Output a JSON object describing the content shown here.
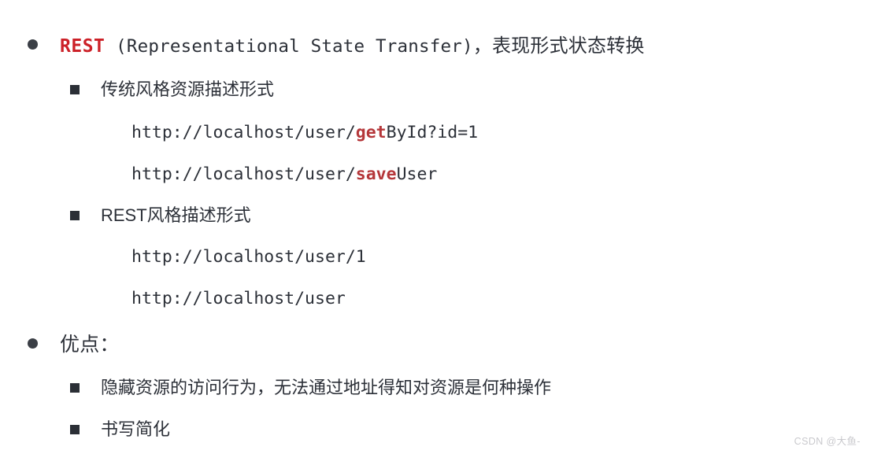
{
  "slide": {
    "background_color": "#ffffff",
    "text_color": "#2c3038",
    "accent_red": "#cc2128",
    "keyword_red": "#b5373a",
    "items": [
      {
        "level": 1,
        "marker": "round-bullet",
        "keyword": "REST",
        "expansion": " (Representational State Transfer)",
        "comma": "，",
        "translation": "表现形式状态转换"
      },
      {
        "level": 2,
        "marker": "square-bullet",
        "text": "传统风格资源描述形式"
      },
      {
        "level": 3,
        "prefix": "http://localhost/user/",
        "highlight": "get",
        "suffix": "ById?id=1"
      },
      {
        "level": 3,
        "prefix": "http://localhost/user/",
        "highlight": "save",
        "suffix": "User"
      },
      {
        "level": 2,
        "marker": "square-bullet",
        "text": "REST风格描述形式"
      },
      {
        "level": 3,
        "prefix": "http://localhost/user/1",
        "highlight": "",
        "suffix": ""
      },
      {
        "level": 3,
        "prefix": "http://localhost/user",
        "highlight": "",
        "suffix": ""
      },
      {
        "level": 1,
        "marker": "round-bullet",
        "text": "优点："
      },
      {
        "level": 2,
        "marker": "square-bullet",
        "text": "隐藏资源的访问行为，无法通过地址得知对资源是何种操作"
      },
      {
        "level": 2,
        "marker": "square-bullet",
        "text": "书写简化"
      }
    ]
  },
  "watermark": {
    "text": "CSDN @大鱼-"
  }
}
